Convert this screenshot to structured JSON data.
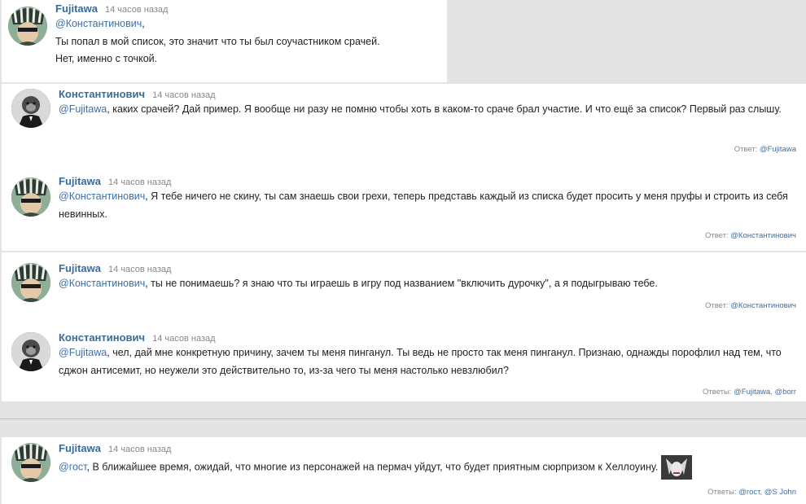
{
  "comments": [
    {
      "author": "Fujitawa",
      "time": "14 часов назад",
      "mention": "@Константинович",
      "text_after_mention": ",",
      "lines": [
        "Ты попал в мой список, это значит что ты был соучастником срачей.",
        "Нет, именно с точкой."
      ]
    },
    {
      "author": "Константинович",
      "time": "14 часов назад",
      "mention": "@Fujitawa",
      "text": ", каких срачей? Дай пример. Я вообще ни разу не помню чтобы хоть в каком-то сраче брал участие. И что ещё за список? Первый раз слышу.",
      "reply_label": "Ответ:",
      "reply_links": [
        "@Fujitawa"
      ]
    },
    {
      "author": "Fujitawa",
      "time": "14 часов назад",
      "mention": "@Константинович",
      "text": ", Я тебе ничего не скину, ты сам знаешь свои грехи, теперь представь каждый из списка будет просить у меня пруфы и строить из себя невинных.",
      "reply_label": "Ответ:",
      "reply_links": [
        "@Константинович"
      ]
    },
    {
      "author": "Fujitawa",
      "time": "14 часов назад",
      "mention": "@Константинович",
      "text": ", ты не понимаешь? я знаю что ты играешь в игру под названием \"включить дурочку\", а я подыгрываю тебе.",
      "reply_label": "Ответ:",
      "reply_links": [
        "@Константинович"
      ]
    },
    {
      "author": "Константинович",
      "time": "14 часов назад",
      "mention": "@Fujitawa",
      "text": ", чел, дай мне конкретную причину, зачем ты меня пинганул. Ты ведь не просто так меня пинганул. Признаю, однажды порофлил над тем, что сджон антисемит, но неужели это действительно то, из-за чего ты меня настолько невзлюбил?",
      "reply_label": "Ответы:",
      "reply_links": [
        "@Fujitawa",
        "@borr"
      ]
    },
    {
      "author": "Fujitawa",
      "time": "14 часов назад",
      "mention": "@гост",
      "text": ", В ближайшее время, ожидай, что многие из персонажей на пермач уйдут, что будет приятным сюрпризом к Хеллоуину.",
      "reply_label": "Ответы:",
      "reply_links": [
        "@гост",
        "@S John"
      ]
    }
  ]
}
